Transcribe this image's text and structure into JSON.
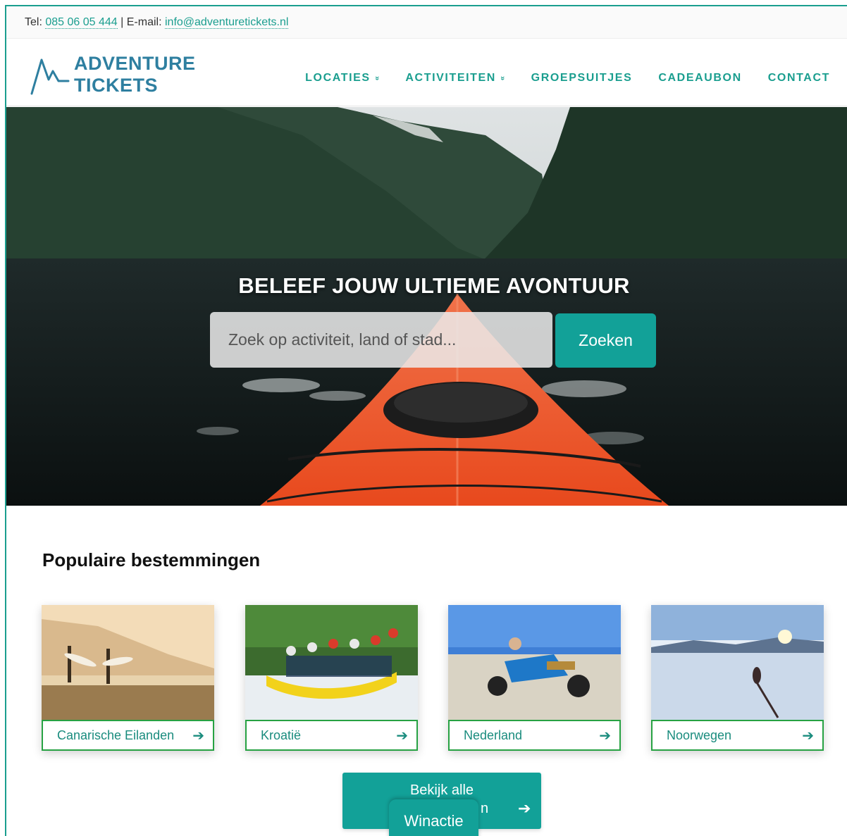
{
  "topbar": {
    "tel_label": "Tel:",
    "phone": "085 06 05 444",
    "separator": "| E-mail:",
    "email": "info@adventuretickets.nl"
  },
  "logo": {
    "line1": "ADVENTURE",
    "line2": "TICKETS"
  },
  "nav": {
    "items": [
      {
        "label": "LOCATIES",
        "has_dropdown": true
      },
      {
        "label": "ACTIVITEITEN",
        "has_dropdown": true
      },
      {
        "label": "GROEPSUITJES",
        "has_dropdown": false
      },
      {
        "label": "CADEAUBON",
        "has_dropdown": false
      },
      {
        "label": "CONTACT",
        "has_dropdown": false
      }
    ],
    "dropdown_glyph": "»"
  },
  "hero": {
    "title": "BELEEF JOUW ULTIEME AVONTUUR",
    "search_placeholder": "Zoek op activiteit, land of stad...",
    "search_button": "Zoeken"
  },
  "destinations": {
    "title": "Populaire bestemmingen",
    "items": [
      {
        "label": "Canarische Eilanden",
        "icon": "arrow-right-icon"
      },
      {
        "label": "Kroatië",
        "icon": "arrow-right-icon"
      },
      {
        "label": "Nederland",
        "icon": "arrow-right-icon"
      },
      {
        "label": "Noorwegen",
        "icon": "arrow-right-icon"
      }
    ],
    "arrow_glyph": "➔"
  },
  "more_button": {
    "line1": "Bekijk alle",
    "line2_visible": "n",
    "arrow": "➔"
  },
  "win_tab": {
    "label": "Winactie"
  },
  "colors": {
    "accent": "#12a198",
    "logo": "#2e7fa0",
    "card_border": "#27a243"
  }
}
